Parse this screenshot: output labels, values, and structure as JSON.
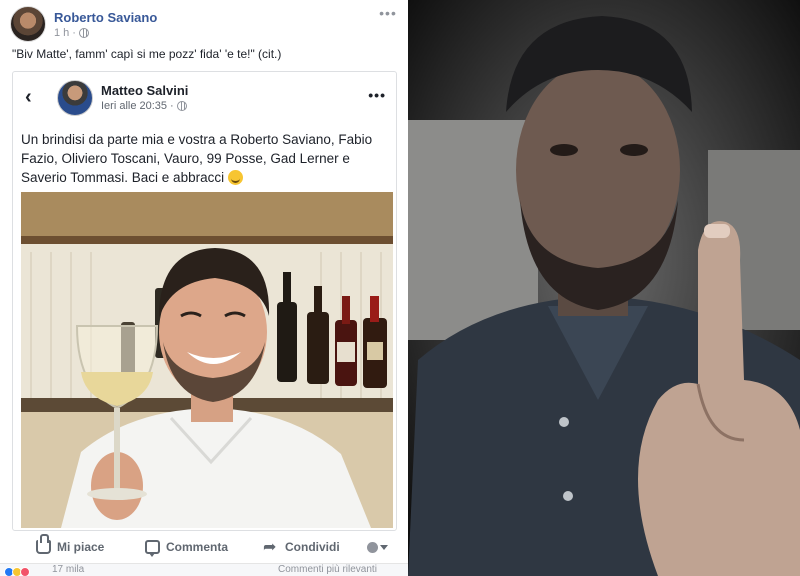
{
  "post": {
    "author": "Roberto Saviano",
    "time": "1 h",
    "caption": "\"Biv Matte', famm' capì si me pozz' fida' 'e te!\" (cit.)"
  },
  "shared_post": {
    "author": "Matteo Salvini",
    "time": "Ieri alle 20:35",
    "text": "Un brindisi da parte mia e vostra a Roberto Saviano, Fabio Fazio, Oliviero Toscani, Vauro, 99 Posse, Gad Lerner e Saverio Tommasi. Baci e abbracci"
  },
  "actions": {
    "like": "Mi piace",
    "comment": "Commenta",
    "share": "Condividi"
  },
  "footer": {
    "reactions": "17 mila",
    "comments": "Commenti più rilevanti"
  },
  "icons": {
    "post_privacy": "globe-icon",
    "shared_privacy": "globe-icon",
    "emoji": "smile-emoji",
    "audience": "audience-selector-icon"
  },
  "colors": {
    "link": "#385898",
    "text": "#1d2129",
    "meta": "#90949c",
    "emoji": "#f7c531"
  }
}
